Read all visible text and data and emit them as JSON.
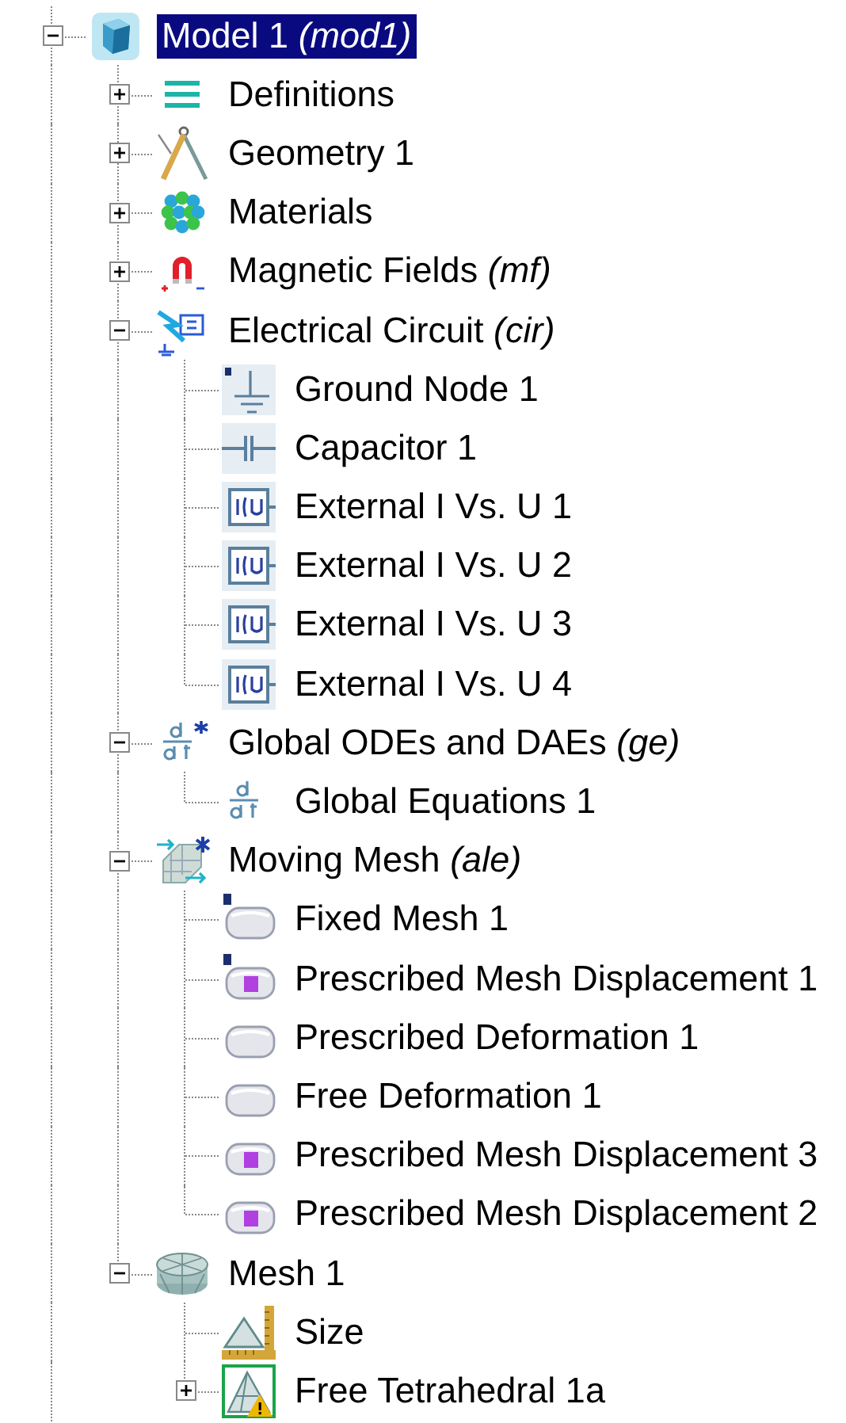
{
  "tree": [
    {
      "label": "Model 1 *(mod1)*",
      "kind": "model",
      "selected": true,
      "expanded": true,
      "children": [
        {
          "label": "Definitions",
          "kind": "definitions",
          "selected": false,
          "expanded": false
        },
        {
          "label": "Geometry 1",
          "kind": "geometry",
          "selected": false,
          "expanded": false
        },
        {
          "label": "Materials",
          "kind": "materials",
          "selected": false,
          "expanded": false
        },
        {
          "label": "Magnetic Fields *(mf)*",
          "kind": "magnet",
          "selected": false,
          "expanded": false
        },
        {
          "label": "Electrical Circuit *(cir)*",
          "kind": "circuit",
          "selected": false,
          "expanded": true,
          "children": [
            {
              "label": "Ground Node 1",
              "kind": "ground",
              "selected": false
            },
            {
              "label": "Capacitor 1",
              "kind": "capacitor",
              "selected": false
            },
            {
              "label": "External I Vs. U 1",
              "kind": "external",
              "selected": false
            },
            {
              "label": "External I Vs. U 2",
              "kind": "external",
              "selected": false
            },
            {
              "label": "External I Vs. U 3",
              "kind": "external",
              "selected": false
            },
            {
              "label": "External I Vs. U 4",
              "kind": "external",
              "selected": false
            }
          ]
        },
        {
          "label": "Global ODEs and DAEs *(ge)*",
          "kind": "ode",
          "selected": false,
          "expanded": true,
          "children": [
            {
              "label": "Global Equations 1",
              "kind": "equation",
              "selected": false
            }
          ]
        },
        {
          "label": "Moving Mesh *(ale)*",
          "kind": "moving-mesh",
          "selected": false,
          "expanded": true,
          "children": [
            {
              "label": "Fixed Mesh 1",
              "kind": "fixed",
              "selected": false
            },
            {
              "label": "Prescribed Mesh Displacement 1",
              "kind": "displacement-default",
              "selected": false
            },
            {
              "label": "Prescribed Deformation 1",
              "kind": "deformation",
              "selected": false
            },
            {
              "label": "Free Deformation 1",
              "kind": "deformation",
              "selected": false
            },
            {
              "label": "Prescribed Mesh Displacement 3",
              "kind": "displacement",
              "selected": false
            },
            {
              "label": "Prescribed Mesh Displacement 2",
              "kind": "displacement",
              "selected": false
            }
          ]
        },
        {
          "label": "Mesh 1",
          "kind": "mesh",
          "selected": false,
          "expanded": true,
          "children": [
            {
              "label": "Size",
              "kind": "size",
              "selected": false
            },
            {
              "label": "Free Tetrahedral 1a",
              "kind": "tetrahedral",
              "selected": false,
              "expanded": false
            }
          ]
        }
      ]
    }
  ]
}
